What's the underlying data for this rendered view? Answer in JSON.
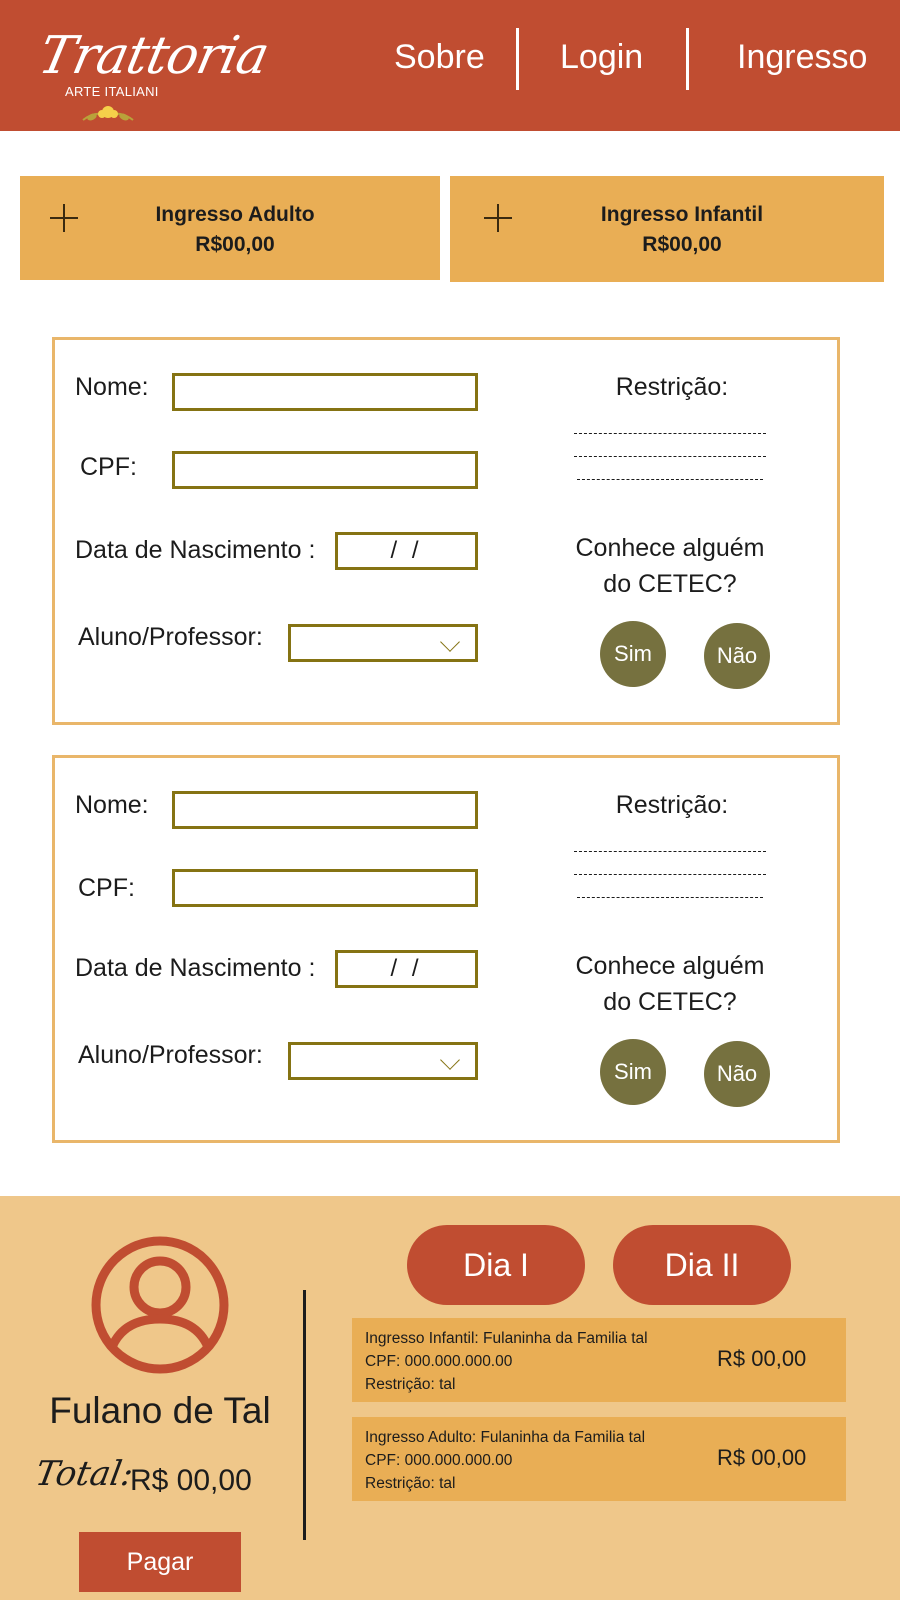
{
  "header": {
    "logo_script": "Trattoria",
    "logo_subtitle": "ARTE ITALIANI",
    "nav": {
      "sobre": "Sobre",
      "login": "Login",
      "ingresso": "Ingresso"
    }
  },
  "tickets": {
    "adult": {
      "title": "Ingresso Adulto",
      "price": "R$00,00"
    },
    "child": {
      "title": "Ingresso Infantil",
      "price": "R$00,00"
    }
  },
  "form": {
    "name_label": "Nome:",
    "cpf_label": "CPF:",
    "birth_label": "Data de Nascimento :",
    "birth_placeholder": "/ /",
    "role_label": "Aluno/Professor:",
    "restriction_label": "Restrição:",
    "know_line1": "Conhece alguém",
    "know_line2": "do CETEC?",
    "yes": "Sim",
    "no": "Não"
  },
  "footer": {
    "user_name": "Fulano de Tal",
    "total_label": "Total:",
    "total_value": "R$ 00,00",
    "pay": "Pagar",
    "day1": "Dia I",
    "day2": "Dia II",
    "summaries": [
      {
        "line1": "Ingresso Infantil: Fulaninha da Familia tal",
        "line2": "CPF: 000.000.000.00",
        "line3": "Restrição: tal",
        "price": "R$ 00,00"
      },
      {
        "line1": "Ingresso Adulto: Fulaninha da Familia tal",
        "line2": "CPF: 000.000.000.00",
        "line3": "Restrição: tal",
        "price": "R$ 00,00"
      }
    ]
  },
  "colors": {
    "brand_red": "#c04d31",
    "ticket_orange": "#e9ae55",
    "card_border": "#e9b66a",
    "field_border": "#857313",
    "olive_button": "#76713f",
    "footer_bg": "#efc78a"
  },
  "icons": {
    "plus": "plus-icon",
    "chevron": "chevron-down-icon",
    "avatar": "user-avatar-icon",
    "leaf": "leaf-ornament-icon"
  }
}
